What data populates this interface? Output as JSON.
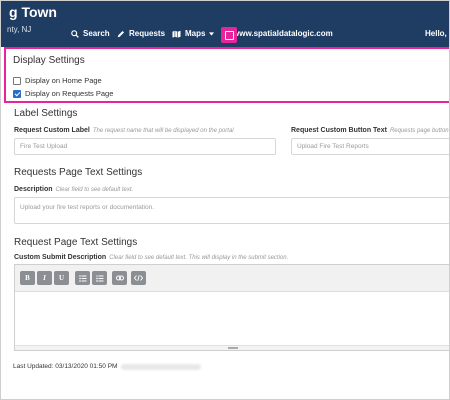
{
  "navbar": {
    "brand_title": "g Town",
    "brand_subtitle": "nty, NJ",
    "search": "Search",
    "requests": "Requests",
    "maps": "Maps",
    "url": "www.spatialdatalogic.com",
    "user": "Hello, M",
    "accent_color": "#e6249b",
    "bg_color": "#1f3d63"
  },
  "display_settings": {
    "title": "Display Settings",
    "home_page_label": "Display on Home Page",
    "home_page_checked": false,
    "requests_page_label": "Display on Requests Page",
    "requests_page_checked": true
  },
  "label_settings": {
    "title": "Label Settings",
    "custom_label": "Request Custom Label",
    "custom_label_hint": "The request name that will be displayed on the portal",
    "custom_label_placeholder": "Fire Test Upload",
    "button_text_label": "Request Custom Button Text",
    "button_text_hint": "Requests page button",
    "button_text_placeholder": "Upload Fire Test Reports"
  },
  "requests_page_text": {
    "title": "Requests Page Text Settings",
    "description_label": "Description",
    "description_hint": "Clear field to see default text.",
    "description_placeholder": "Upload your fire test reports or documentation."
  },
  "request_page_text": {
    "title": "Request Page Text Settings",
    "submit_label": "Custom Submit Description",
    "submit_hint": "Clear field to see default text. This will display in the submit section.",
    "toolbar": {
      "bold": "B",
      "italic": "I",
      "underline": "U",
      "bullet_list_icon": "bullet-list-icon",
      "numbered_list_icon": "numbered-list-icon",
      "link_icon": "link-icon",
      "code_icon": "code-icon"
    }
  },
  "footer": {
    "last_updated": "Last Updated: 03/13/2020 01:50 PM"
  }
}
